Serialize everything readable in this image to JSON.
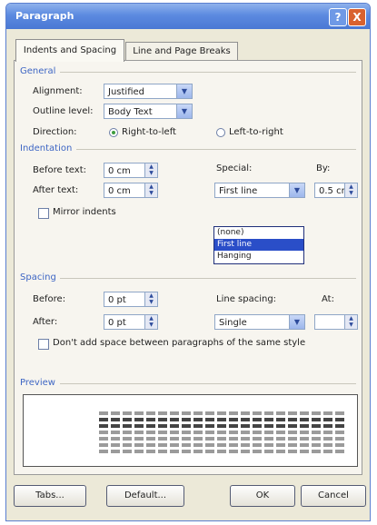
{
  "window": {
    "title": "Paragraph",
    "help_label": "?",
    "close_label": "X"
  },
  "tabs": [
    {
      "label": "Indents and Spacing"
    },
    {
      "label": "Line and Page Breaks"
    }
  ],
  "general": {
    "section_label": "General",
    "alignment_label": "Alignment:",
    "alignment_value": "Justified",
    "outline_label": "Outline level:",
    "outline_value": "Body Text",
    "direction_label": "Direction:",
    "rtl_label": "Right-to-left",
    "ltr_label": "Left-to-right"
  },
  "indentation": {
    "section_label": "Indentation",
    "before_label": "Before text:",
    "before_value": "0 cm",
    "after_label": "After text:",
    "after_value": "0 cm",
    "special_label": "Special:",
    "special_value": "First line",
    "by_label": "By:",
    "by_value": "0.5 cm",
    "mirror_label": "Mirror indents",
    "special_options": [
      "(none)",
      "First line",
      "Hanging"
    ]
  },
  "spacing": {
    "section_label": "Spacing",
    "before_label": "Before:",
    "before_value": "0 pt",
    "after_label": "After:",
    "after_value": "0 pt",
    "line_label": "Line spacing:",
    "line_value": "Single",
    "at_label": "At:",
    "at_value": "",
    "dont_add_label": "Don't add space between paragraphs of the same style"
  },
  "preview": {
    "section_label": "Preview"
  },
  "buttons": {
    "tabs_label": "Tabs...",
    "default_label": "Default...",
    "ok_label": "OK",
    "cancel_label": "Cancel"
  }
}
